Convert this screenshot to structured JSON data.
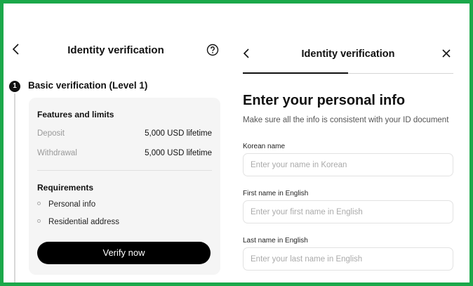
{
  "left_panel": {
    "title": "Identity verification",
    "step_number": "1",
    "step_title": "Basic verification (Level 1)",
    "features_heading": "Features and limits",
    "limits": [
      {
        "label": "Deposit",
        "value": "5,000 USD lifetime"
      },
      {
        "label": "Withdrawal",
        "value": "5,000 USD lifetime"
      }
    ],
    "requirements_heading": "Requirements",
    "requirements": [
      "Personal info",
      "Residential address"
    ],
    "verify_button": "Verify now"
  },
  "right_panel": {
    "title": "Identity verification",
    "progress_fraction": 0.5,
    "heading": "Enter your personal info",
    "subheading": "Make sure all the info is consistent with your ID document",
    "fields": [
      {
        "label": "Korean name",
        "placeholder": "Enter your name in Korean",
        "value": ""
      },
      {
        "label": "First name in English",
        "placeholder": "Enter your first name in English",
        "value": ""
      },
      {
        "label": "Last name in English",
        "placeholder": "Enter your last name in English",
        "value": ""
      }
    ]
  },
  "colors": {
    "frame_border": "#1ba84a",
    "button_bg": "#000000",
    "card_bg": "#f5f5f5"
  },
  "icons": [
    "back-arrow-icon",
    "help-circle-icon",
    "close-icon",
    "bullet-icon"
  ]
}
